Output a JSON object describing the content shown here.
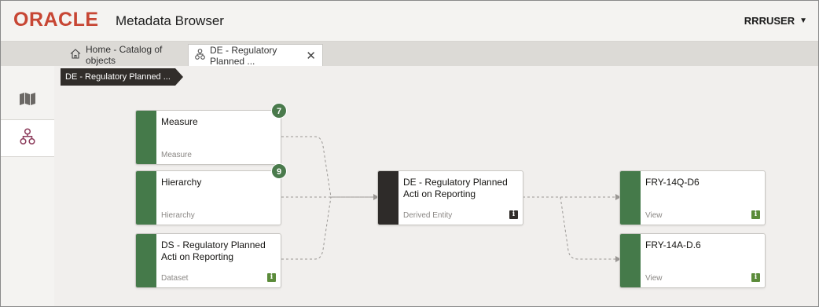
{
  "header": {
    "logo_text": "ORACLE",
    "app_title": "Metadata Browser",
    "user": "RRRUSER"
  },
  "tabs": [
    {
      "label": "Home - Catalog of objects",
      "icon": "home-icon"
    },
    {
      "label": "DE - Regulatory Planned ...",
      "icon": "lineage-icon",
      "close": "✕"
    }
  ],
  "leftnav": [
    {
      "icon": "map-icon"
    },
    {
      "icon": "lineage-icon"
    }
  ],
  "breadcrumb": {
    "label": "DE - Regulatory Planned ..."
  },
  "nodes": {
    "measure": {
      "title": "Measure",
      "type": "Measure",
      "badge": "7"
    },
    "hierarchy": {
      "title": "Hierarchy",
      "type": "Hierarchy",
      "badge": "9"
    },
    "dataset": {
      "title": "DS - Regulatory Planned Acti on Reporting",
      "type": "Dataset",
      "info": "i"
    },
    "derived": {
      "title": "DE - Regulatory Planned Acti on Reporting",
      "type": "Derived Entity",
      "info": "i"
    },
    "fry14q": {
      "title": "FRY-14Q-D6",
      "type": "View",
      "info": "i"
    },
    "fry14a": {
      "title": "FRY-14A-D.6",
      "type": "View",
      "info": "i"
    }
  },
  "colors": {
    "oracle_red": "#c74634",
    "green_bar": "#457a4a",
    "dark_bar": "#2e2b29",
    "badge_green": "#4a7a4c",
    "view_info_green": "#5b8b3a",
    "edge": "#9a9794"
  }
}
